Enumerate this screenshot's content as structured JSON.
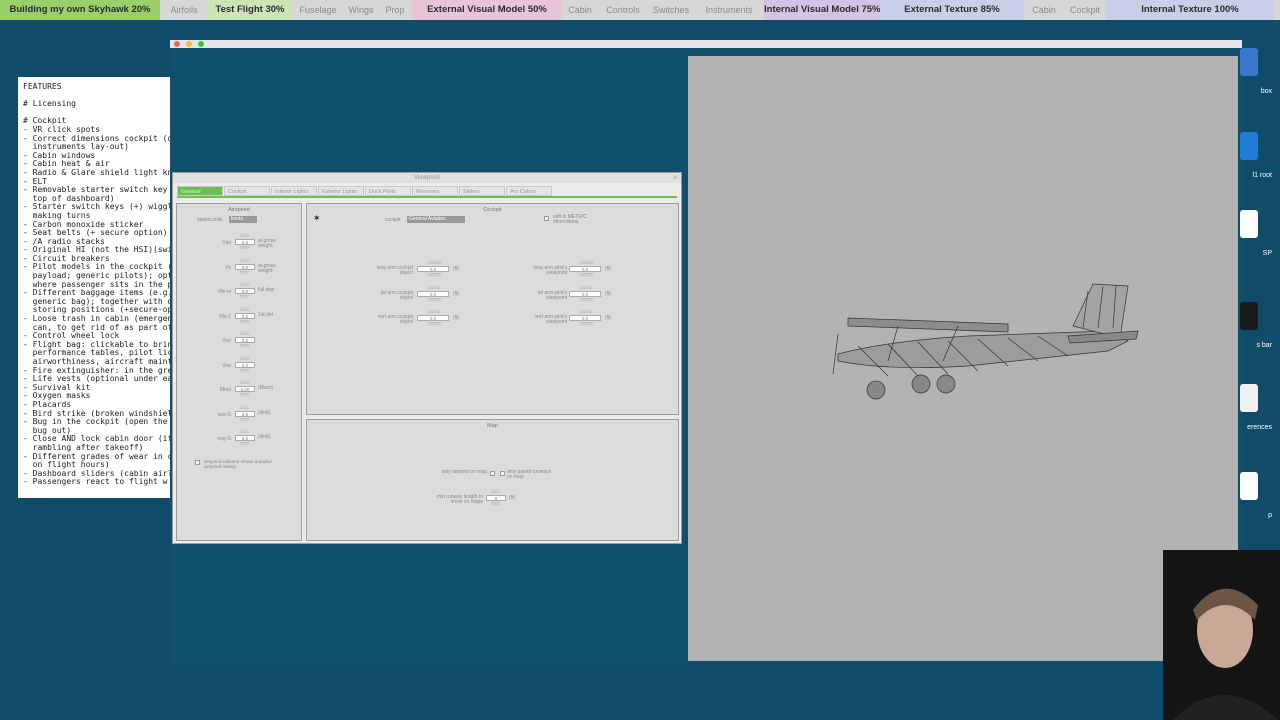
{
  "progress": {
    "fill_fraction": 0.11,
    "segments": [
      {
        "label": "Building my own Skyhawk 20%",
        "milestone": true
      },
      {
        "label": "Airfoils",
        "milestone": false
      },
      {
        "label": "Test Flight 30%",
        "milestone": true
      },
      {
        "label": "Fuselage",
        "milestone": false
      },
      {
        "label": "Wings",
        "milestone": false
      },
      {
        "label": "Prop",
        "milestone": false
      },
      {
        "label": "External Visual Model 50%",
        "milestone": true
      },
      {
        "label": "Cabin",
        "milestone": false
      },
      {
        "label": "Controls",
        "milestone": false
      },
      {
        "label": "Switches",
        "milestone": false
      },
      {
        "label": "Instruments",
        "milestone": false
      },
      {
        "label": "Internal Visual Model 75%",
        "milestone": true
      },
      {
        "label": "External Texture 85%",
        "milestone": true
      },
      {
        "label": "Cabin",
        "milestone": false
      },
      {
        "label": "Cockpit",
        "milestone": false
      },
      {
        "label": "Internal Texture 100%",
        "milestone": true
      }
    ],
    "colors": {
      "fill": "#7ac143",
      "track": "#d7d7d7",
      "milestone_bg": [
        "#9ad06a",
        "#cde4b6",
        "#e9c4d4",
        "#d4c3e6",
        "#c9cfe9"
      ]
    }
  },
  "features_text": "FEATURES\n\n# Licensing\n\n# Cockpit\n- VR click spots\n- Correct dimensions cockpit (d\n  instruments lay-out)\n- Cabin windows\n- Cabin heat & air\n- Radio & Glare shield light kn\n- ELT\n- Removable starter switch key\n  top of dashboard)\n- Starter switch keys (+) wiggl\n  making turns\n- Carbon monoxide sticker\n- Seat belts (+ secure option)\n- /A radio stacks\n- Original HI (not the HSI)(swi\n- Circuit breakers\n- Pilot models in the cockpit (\n  payload; generic pilots); optio\n  where passenger sits in the pla\n- Different baggage items (e.g.\n  generic bag); together with dif\n  storing positions (+secure-opt\n- Loose trash in cabin (emergen\n  can, to get rid of as part of p\n- Control wheel lock\n- Flight bag: clickable to brin\n  performance tables, pilot licen\n  airworthiness, aircraft mainten\n- Fire extinguisher: in the gre\n- Life vests (optional under ea\n- Survival kit\n- Oxygen masks\n- Placards\n- Bird strike (broken windshiel\n- Bug in the cockpit (open the\n  bug out)\n- Close AND lock cabin door (if\n  rambling after takeoff)\n- Different grades of wear in c\n  on flight hours)\n- Dashboard sliders (cabin air?\n- Passengers react to flight w",
  "dialog": {
    "title": "Viewpoint",
    "tabs": [
      "General",
      "Cockpit",
      "Interior Lights",
      "Exterior Lights",
      "Dock Ports",
      "Reserves",
      "Sliders",
      "Arc Colors"
    ],
    "airspeed": {
      "title": "Airspeed",
      "speed_units_label": "speed units",
      "speed_units_value": "knots",
      "rows": [
        {
          "label": "Vso",
          "value": "0.0",
          "note": "at gross weight"
        },
        {
          "label": "Vs",
          "value": "0.0",
          "note": "at gross weight"
        },
        {
          "label": "Vfe-m",
          "value": "0.0",
          "note": "full dep"
        },
        {
          "label": "Vfe-1",
          "value": "0.0",
          "note": "1st det"
        },
        {
          "label": "Vno",
          "value": "0.0",
          "note": ""
        },
        {
          "label": "Vne",
          "value": "0.0",
          "note": ""
        },
        {
          "label": "Mmo",
          "value": "0.00",
          "note": "(Mach)"
        },
        {
          "label": "pos G",
          "value": "9.9",
          "note": "(limit)"
        },
        {
          "label": "neg G",
          "value": "0.0",
          "note": "(limit)"
        }
      ],
      "checkbox_label": "airspeed indicator shows autopilot airspeed setting"
    },
    "cockpit": {
      "title": "Cockpit",
      "cockpit_label": "cockpit",
      "cockpit_value": "General Aviation",
      "metric_label": "edit in METRIC dimensions",
      "left_rows": [
        {
          "label": "long arm cockpit object",
          "value": "0.0",
          "unit": "(ft)"
        },
        {
          "label": "lat arm cockpit object",
          "value": "0.0",
          "unit": "(ft)"
        },
        {
          "label": "vert arm cockpit object",
          "value": "0.0",
          "unit": "(ft)"
        }
      ],
      "right_rows": [
        {
          "label": "long arm pilot's viewpoint",
          "value": "0.0",
          "unit": "(ft)"
        },
        {
          "label": "lat arm pilot's viewpoint",
          "value": "0.0",
          "unit": "(ft)"
        },
        {
          "label": "vert arm pilot's viewpoint",
          "value": "0.0",
          "unit": "(ft)"
        }
      ]
    },
    "map": {
      "title": "Map",
      "airports_label": "only airports on map",
      "paved_label": "only paved runways on map",
      "runway_label": "min runway length to show on maps",
      "runway_value": "0",
      "runway_unit": "(ft)"
    }
  },
  "dock": [
    {
      "label": "box",
      "icon": "app-icon",
      "color": "#3a78d0"
    },
    {
      "label": "l1 root",
      "icon": "xcode-icon",
      "color": "#1f7dd6"
    },
    {
      "label": "SP",
      "icon": "tools-icon",
      "color": "#ffffff"
    },
    {
      "label": "s bar",
      "icon": "terminal-icon",
      "color": "#1a1a1a"
    },
    {
      "label": "erences",
      "icon": "pen-icon",
      "color": "#f0f0f0"
    },
    {
      "label": "p",
      "icon": "document-icon",
      "color": "#ffffff"
    }
  ]
}
